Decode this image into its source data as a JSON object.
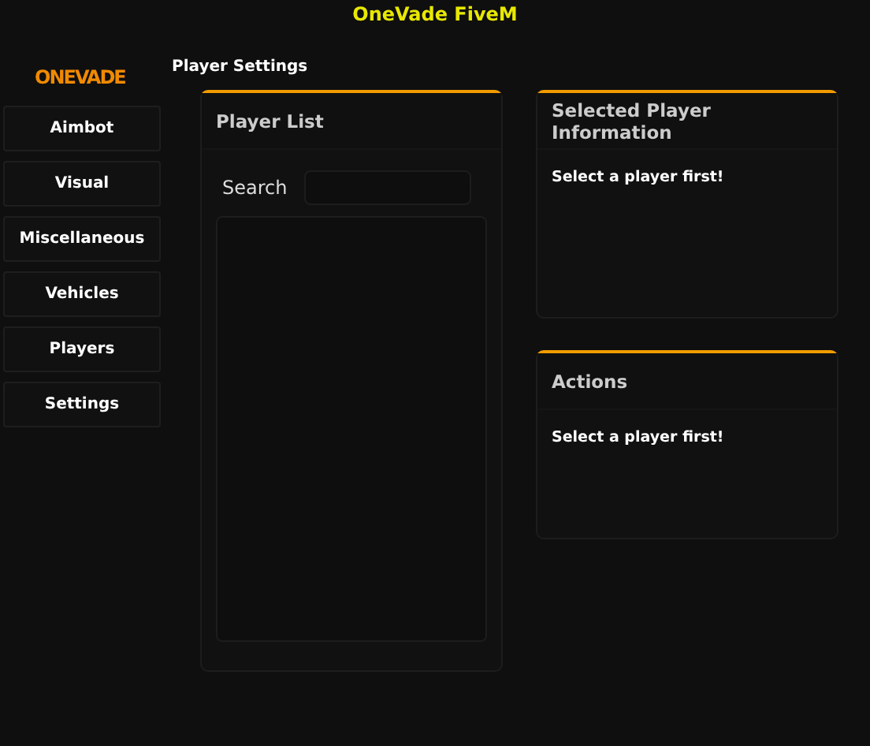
{
  "window": {
    "title": "OneVade FiveM"
  },
  "logo": "ONEVADE",
  "sidebar": {
    "items": [
      "Aimbot",
      "Visual",
      "Miscellaneous",
      "Vehicles",
      "Players",
      "Settings"
    ]
  },
  "section_title": "Player Settings",
  "player_list": {
    "title": "Player List",
    "search": {
      "label": "Search"
    }
  },
  "info_panel": {
    "title": "Selected Player Information",
    "message": "Select a player first!"
  },
  "actions_panel": {
    "title": "Actions",
    "message": "Select a player first!"
  }
}
